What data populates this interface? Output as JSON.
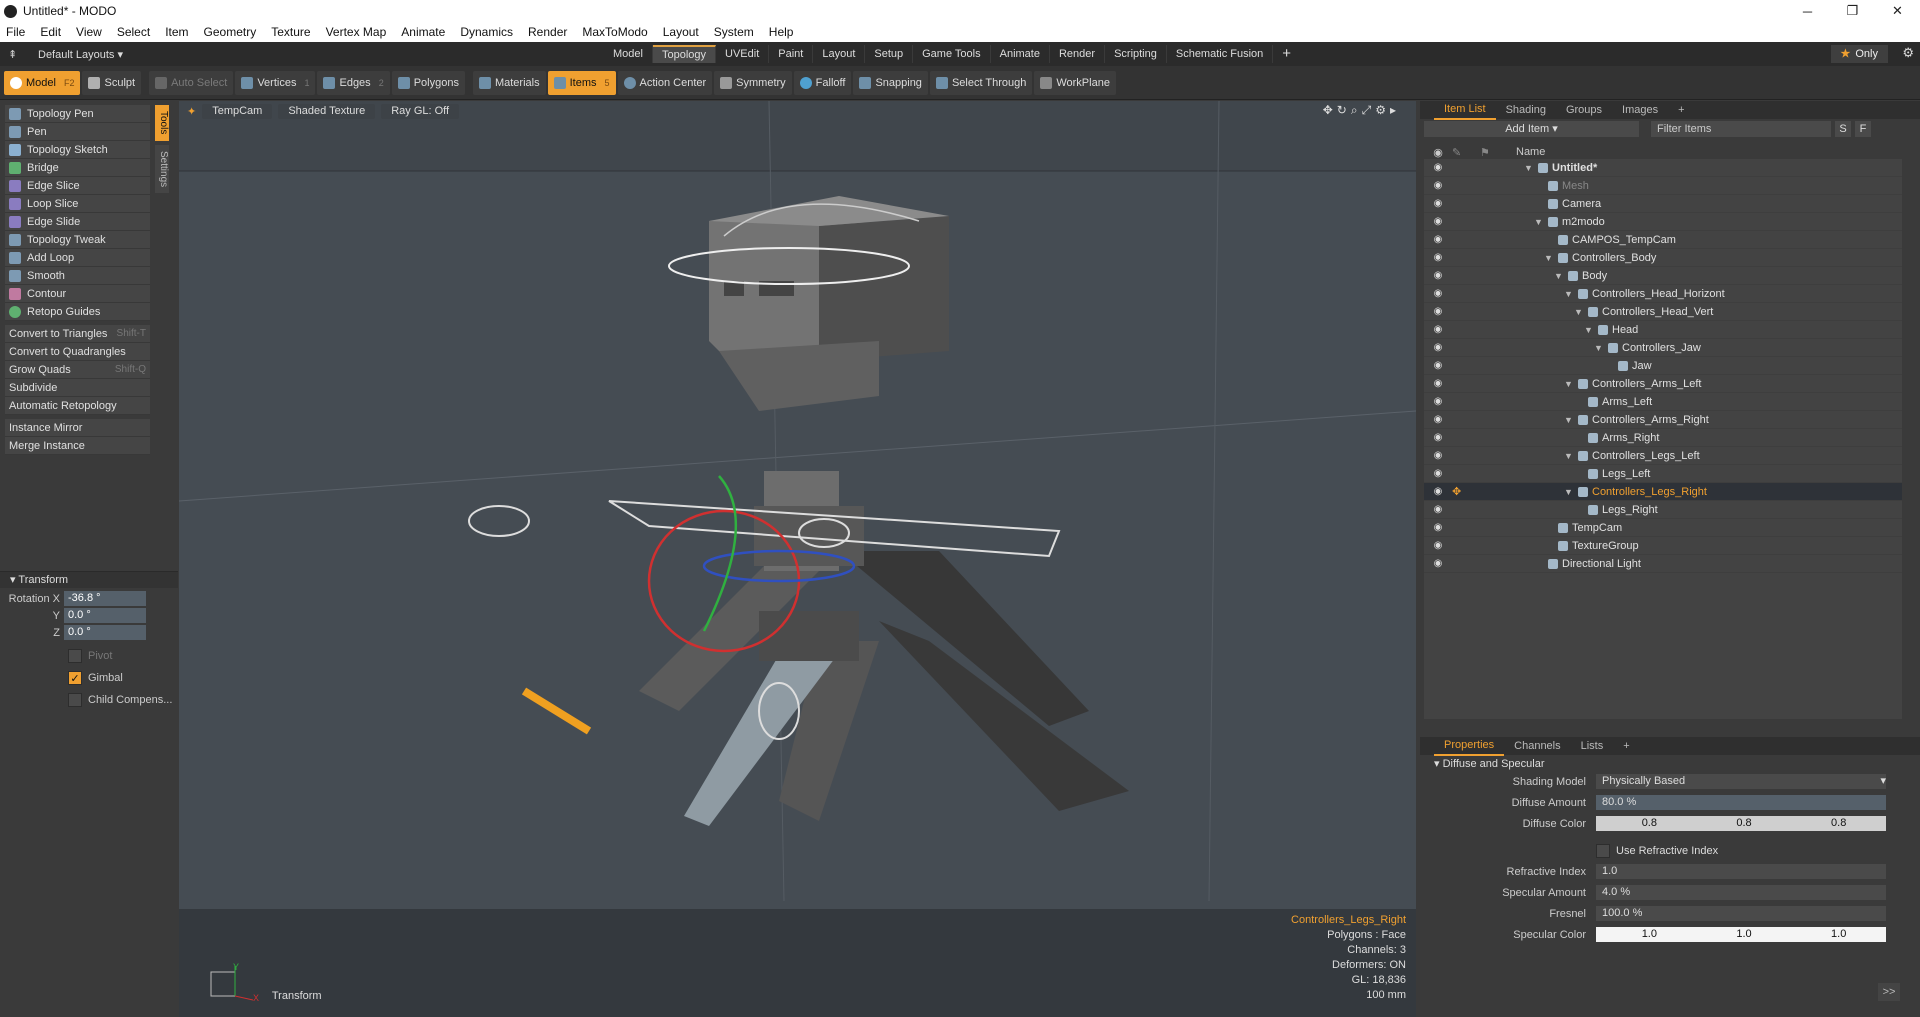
{
  "window": {
    "title": "Untitled* - MODO"
  },
  "menu": [
    "File",
    "Edit",
    "View",
    "Select",
    "Item",
    "Geometry",
    "Texture",
    "Vertex Map",
    "Animate",
    "Dynamics",
    "Render",
    "MaxToModo",
    "Layout",
    "System",
    "Help"
  ],
  "layout": {
    "default": "Default Layouts",
    "tabs": [
      "Model",
      "Topology",
      "UVEdit",
      "Paint",
      "Layout",
      "Setup",
      "Game Tools",
      "Animate",
      "Render",
      "Scripting",
      "Schematic Fusion"
    ],
    "active_tab": "Topology",
    "only": "Only"
  },
  "toolbar": {
    "model": "Model",
    "model_key": "F2",
    "sculpt": "Sculpt",
    "auto_select": "Auto Select",
    "vertices": "Vertices",
    "vertices_key": "1",
    "edges": "Edges",
    "edges_key": "2",
    "polygons": "Polygons",
    "materials": "Materials",
    "items": "Items",
    "items_key": "5",
    "action_center": "Action Center",
    "symmetry": "Symmetry",
    "falloff": "Falloff",
    "snapping": "Snapping",
    "select_through": "Select Through",
    "workplane": "WorkPlane"
  },
  "tools": {
    "group1": [
      "Topology Pen",
      "Pen",
      "Topology Sketch",
      "Bridge",
      "Edge Slice",
      "Loop Slice",
      "Edge Slide",
      "Topology Tweak",
      "Add Loop",
      "Smooth",
      "Contour",
      "Retopo Guides"
    ],
    "group2": [
      {
        "label": "Convert to Triangles",
        "key": "Shift-T"
      },
      {
        "label": "Convert to Quadrangles",
        "key": ""
      },
      {
        "label": "Grow Quads",
        "key": "Shift-Q"
      },
      {
        "label": "Subdivide",
        "key": ""
      },
      {
        "label": "Automatic Retopology",
        "key": ""
      }
    ],
    "group3": [
      "Instance Mirror",
      "Merge Instance"
    ],
    "side_tabs": [
      "Tools",
      "Settings"
    ]
  },
  "transform": {
    "header": "Transform",
    "rotation_label": "Rotation X",
    "rx": "-36.8 °",
    "y_label": "Y",
    "ry": "0.0 °",
    "z_label": "Z",
    "rz": "0.0 °",
    "pivot": "Pivot",
    "gimbal": "Gimbal",
    "child": "Child Compens..."
  },
  "viewport": {
    "cam": "TempCam",
    "shading": "Shaded Texture",
    "raygl": "Ray GL: Off",
    "sel": "Controllers_Legs_Right",
    "poly": "Polygons : Face",
    "chan": "Channels: 3",
    "deform": "Deformers: ON",
    "gl": "GL: 18,836",
    "size": "100 mm",
    "axis_label": "Transform"
  },
  "itemlist": {
    "tabs": [
      "Item List",
      "Shading",
      "Groups",
      "Images"
    ],
    "add_item": "Add Item",
    "filter": "Filter Items",
    "col_name": "Name",
    "items": [
      {
        "name": "Untitled*",
        "depth": 0
      },
      {
        "name": "Mesh",
        "depth": 1
      },
      {
        "name": "Camera",
        "depth": 1
      },
      {
        "name": "m2modo",
        "depth": 1
      },
      {
        "name": "CAMPOS_TempCam",
        "depth": 2
      },
      {
        "name": "Controllers_Body",
        "depth": 2
      },
      {
        "name": "Body",
        "depth": 3
      },
      {
        "name": "Controllers_Head_Horizont",
        "depth": 4
      },
      {
        "name": "Controllers_Head_Vert",
        "depth": 5
      },
      {
        "name": "Head",
        "depth": 6
      },
      {
        "name": "Controllers_Jaw",
        "depth": 7
      },
      {
        "name": "Jaw",
        "depth": 8
      },
      {
        "name": "Controllers_Arms_Left",
        "depth": 4
      },
      {
        "name": "Arms_Left",
        "depth": 5
      },
      {
        "name": "Controllers_Arms_Right",
        "depth": 4
      },
      {
        "name": "Arms_Right",
        "depth": 5
      },
      {
        "name": "Controllers_Legs_Left",
        "depth": 4
      },
      {
        "name": "Legs_Left",
        "depth": 5
      },
      {
        "name": "Controllers_Legs_Right",
        "depth": 4
      },
      {
        "name": "Legs_Right",
        "depth": 5
      },
      {
        "name": "TempCam",
        "depth": 2
      },
      {
        "name": "TextureGroup",
        "depth": 2
      },
      {
        "name": "Directional Light",
        "depth": 1
      }
    ]
  },
  "properties": {
    "tabs": [
      "Properties",
      "Channels",
      "Lists"
    ],
    "section": "Diffuse and Specular",
    "shading_model_l": "Shading Model",
    "shading_model": "Physically Based",
    "diffuse_amount_l": "Diffuse Amount",
    "diffuse_amount": "80.0 %",
    "diffuse_color_l": "Diffuse Color",
    "dc1": "0.8",
    "dc2": "0.8",
    "dc3": "0.8",
    "refractive_l": "Use Refractive Index",
    "ri_l": "Refractive Index",
    "ri": "1.0",
    "spec_amount_l": "Specular Amount",
    "spec_amount": "4.0 %",
    "fresnel_l": "Fresnel",
    "fresnel": "100.0 %",
    "spec_color_l": "Specular Color",
    "sc1": "1.0",
    "sc2": "1.0",
    "sc3": "1.0"
  }
}
